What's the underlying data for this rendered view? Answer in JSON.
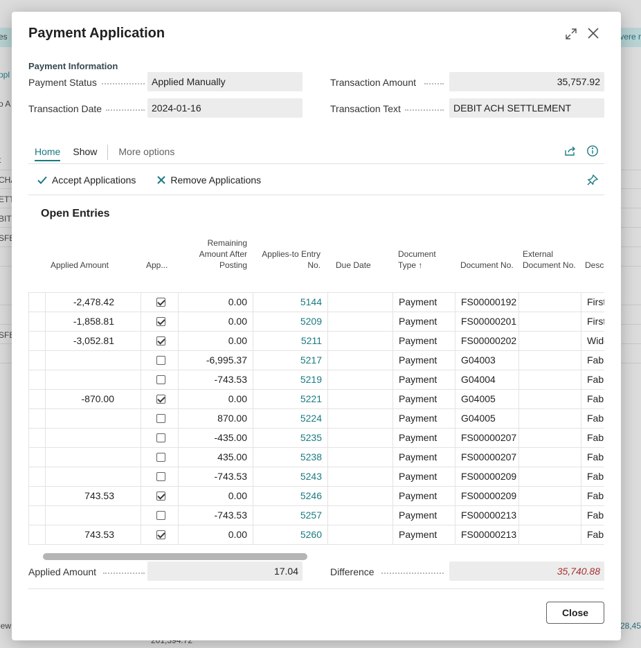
{
  "dialog": {
    "title": "Payment Application",
    "section_label": "Payment Information",
    "payment_status_label": "Payment Status",
    "payment_status_value": "Applied Manually",
    "transaction_date_label": "Transaction Date",
    "transaction_date_value": "2024-01-16",
    "transaction_amount_label": "Transaction Amount",
    "transaction_amount_value": "35,757.92",
    "transaction_text_label": "Transaction Text",
    "transaction_text_value": "DEBIT ACH SETTLEMENT",
    "applied_amount_label": "Applied Amount",
    "applied_amount_value": "17.04",
    "difference_label": "Difference",
    "difference_value": "35,740.88",
    "close_label": "Close"
  },
  "tabs": {
    "home": "Home",
    "show": "Show",
    "more": "More options"
  },
  "actions": {
    "accept": "Accept Applications",
    "remove": "Remove Applications"
  },
  "subtitle": "Open Entries",
  "columns": {
    "applied_amount": "Applied Amount",
    "applied": "App...",
    "remaining": "Remaining Amount After Posting",
    "entry_no": "Applies-to Entry No.",
    "due_date": "Due Date",
    "doc_type": "Document Type ↑",
    "doc_no": "Document No.",
    "ext_doc_no": "External Document No.",
    "description": "Descr"
  },
  "rows": [
    {
      "applied_amount": "-2,478.42",
      "applied": true,
      "remaining": "0.00",
      "entry_no": "5144",
      "due_date": "",
      "doc_type": "Payment",
      "doc_no": "FS00000192",
      "ext_doc_no": "",
      "description": "First"
    },
    {
      "applied_amount": "-1,858.81",
      "applied": true,
      "remaining": "0.00",
      "entry_no": "5209",
      "due_date": "",
      "doc_type": "Payment",
      "doc_no": "FS00000201",
      "ext_doc_no": "",
      "description": "First"
    },
    {
      "applied_amount": "-3,052.81",
      "applied": true,
      "remaining": "0.00",
      "entry_no": "5211",
      "due_date": "",
      "doc_type": "Payment",
      "doc_no": "FS00000202",
      "ext_doc_no": "",
      "description": "Wide"
    },
    {
      "applied_amount": "",
      "applied": false,
      "remaining": "-6,995.37",
      "entry_no": "5217",
      "due_date": "",
      "doc_type": "Payment",
      "doc_no": "G04003",
      "ext_doc_no": "",
      "description": "Fabr"
    },
    {
      "applied_amount": "",
      "applied": false,
      "remaining": "-743.53",
      "entry_no": "5219",
      "due_date": "",
      "doc_type": "Payment",
      "doc_no": "G04004",
      "ext_doc_no": "",
      "description": "Fabr"
    },
    {
      "applied_amount": "-870.00",
      "applied": true,
      "remaining": "0.00",
      "entry_no": "5221",
      "due_date": "",
      "doc_type": "Payment",
      "doc_no": "G04005",
      "ext_doc_no": "",
      "description": "Fabr"
    },
    {
      "applied_amount": "",
      "applied": false,
      "remaining": "870.00",
      "entry_no": "5224",
      "due_date": "",
      "doc_type": "Payment",
      "doc_no": "G04005",
      "ext_doc_no": "",
      "description": "Fabr"
    },
    {
      "applied_amount": "",
      "applied": false,
      "remaining": "-435.00",
      "entry_no": "5235",
      "due_date": "",
      "doc_type": "Payment",
      "doc_no": "FS00000207",
      "ext_doc_no": "",
      "description": "Fabr"
    },
    {
      "applied_amount": "",
      "applied": false,
      "remaining": "435.00",
      "entry_no": "5238",
      "due_date": "",
      "doc_type": "Payment",
      "doc_no": "FS00000207",
      "ext_doc_no": "",
      "description": "Fabr"
    },
    {
      "applied_amount": "",
      "applied": false,
      "remaining": "-743.53",
      "entry_no": "5243",
      "due_date": "",
      "doc_type": "Payment",
      "doc_no": "FS00000209",
      "ext_doc_no": "",
      "description": "Fabr"
    },
    {
      "applied_amount": "743.53",
      "applied": true,
      "remaining": "0.00",
      "entry_no": "5246",
      "due_date": "",
      "doc_type": "Payment",
      "doc_no": "FS00000209",
      "ext_doc_no": "",
      "description": "Fabr"
    },
    {
      "applied_amount": "",
      "applied": false,
      "remaining": "-743.53",
      "entry_no": "5257",
      "due_date": "",
      "doc_type": "Payment",
      "doc_no": "FS00000213",
      "ext_doc_no": "",
      "description": "Fabr"
    },
    {
      "applied_amount": "743.53",
      "applied": true,
      "remaining": "0.00",
      "entry_no": "5260",
      "due_date": "",
      "doc_type": "Payment",
      "doc_no": "FS00000213",
      "ext_doc_no": "",
      "description": "Fabr"
    }
  ],
  "background": {
    "banner_left": "es",
    "banner_right": "vere r",
    "left_fragments": [
      "ppl",
      "o A",
      "t",
      "CHA",
      "ETT",
      "BIT",
      "SFE",
      "SFE",
      "iew"
    ],
    "right_fragments": [
      "28,45"
    ],
    "bottom_fragment": "201,394.72"
  },
  "colors": {
    "accent": "#1a7a82",
    "difference": "#a83232"
  },
  "icons": [
    "expand-icon",
    "close-icon",
    "share-icon",
    "info-icon",
    "checkmark-icon",
    "x-icon",
    "pin-icon"
  ]
}
